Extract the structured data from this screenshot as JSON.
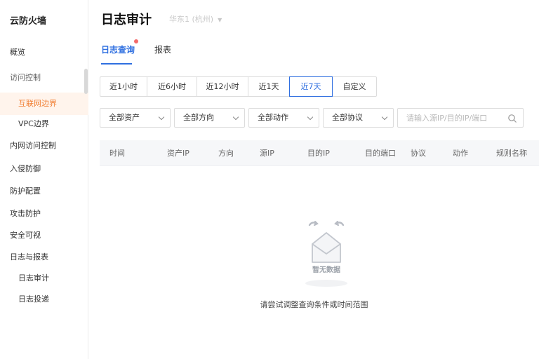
{
  "sidebar": {
    "brand": "云防火墙",
    "items": [
      {
        "label": "概览"
      },
      {
        "label": "访问控制"
      },
      {
        "label": "互联网边界"
      },
      {
        "label": "VPC边界"
      },
      {
        "label": "内网访问控制"
      },
      {
        "label": "入侵防御"
      },
      {
        "label": "防护配置"
      },
      {
        "label": "攻击防护"
      },
      {
        "label": "安全可视"
      },
      {
        "label": "日志与报表"
      },
      {
        "label": "日志审计"
      },
      {
        "label": "日志投递"
      }
    ]
  },
  "header": {
    "title": "日志审计",
    "region": "华东1 (杭州)"
  },
  "tabs": [
    {
      "label": "日志查询"
    },
    {
      "label": "报表"
    }
  ],
  "time_range": {
    "options": [
      "近1小时",
      "近6小时",
      "近12小时",
      "近1天",
      "近7天",
      "自定义"
    ],
    "selected": "近7天"
  },
  "filters": [
    {
      "label": "全部资产"
    },
    {
      "label": "全部方向"
    },
    {
      "label": "全部动作"
    },
    {
      "label": "全部协议"
    }
  ],
  "search": {
    "placeholder": "请输入源IP/目的IP/端口"
  },
  "table": {
    "columns": [
      "时间",
      "资产IP",
      "方向",
      "源IP",
      "目的IP",
      "目的端口",
      "协议",
      "动作",
      "规则名称"
    ]
  },
  "empty": {
    "illustration_text": "暂无数据",
    "message": "请尝试调整查询条件或时间范围"
  },
  "colors": {
    "accent": "#2f6fe0",
    "active_nav": "#f07a2c",
    "active_nav_bg": "#fff4ec"
  }
}
